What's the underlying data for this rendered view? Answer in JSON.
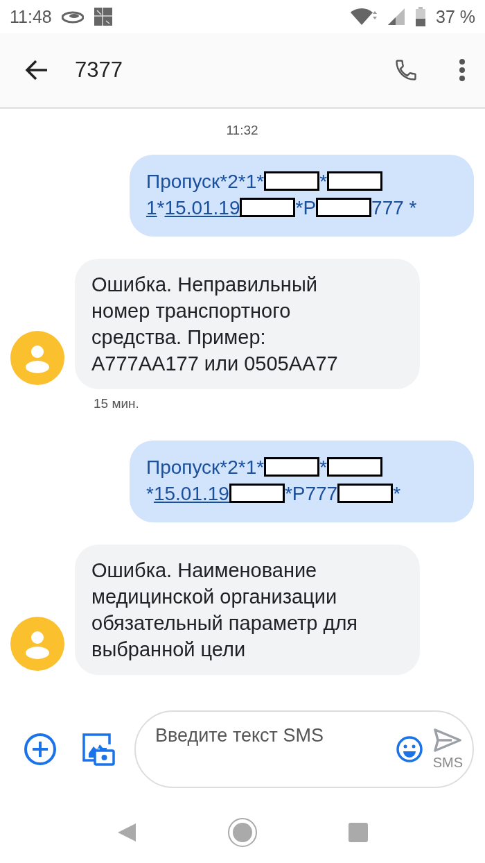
{
  "status_bar": {
    "time": "11:48",
    "battery": "37 %"
  },
  "app_bar": {
    "title": "7377"
  },
  "timestamp": "11:32",
  "messages": [
    {
      "kind": "outgoing",
      "parts": [
        {
          "kind": "text",
          "text": "Пропуск*2*1*"
        },
        {
          "kind": "redaction"
        },
        {
          "kind": "text",
          "text": "*"
        },
        {
          "kind": "redaction"
        },
        {
          "kind": "link",
          "text": "1"
        },
        {
          "kind": "text",
          "text": "*"
        },
        {
          "kind": "link",
          "text": "15.01.19"
        },
        {
          "kind": "redaction"
        },
        {
          "kind": "text",
          "text": "*Р"
        },
        {
          "kind": "redaction"
        },
        {
          "kind": "text",
          "text": "777 *"
        }
      ]
    },
    {
      "kind": "incoming",
      "text": "Ошибка. Неправильный номер транспортного средства. Пример: А777АА177 или 0505АА77",
      "time": "15 мин."
    },
    {
      "kind": "outgoing",
      "parts": [
        {
          "kind": "text",
          "text": "Пропуск*2*1*"
        },
        {
          "kind": "redaction"
        },
        {
          "kind": "text",
          "text": "*"
        },
        {
          "kind": "redaction"
        },
        {
          "kind": "text",
          "text": "*"
        },
        {
          "kind": "link",
          "text": "15.01.19"
        },
        {
          "kind": "redaction"
        },
        {
          "kind": "text",
          "text": "*Р777"
        },
        {
          "kind": "redaction"
        },
        {
          "kind": "text",
          "text": "*"
        }
      ]
    },
    {
      "kind": "incoming",
      "text": "Ошибка. Наименование медицинской организации обязательный параметр для выбранной цели"
    }
  ],
  "composer": {
    "placeholder": "Введите текст SMS",
    "send_label": "SMS"
  }
}
